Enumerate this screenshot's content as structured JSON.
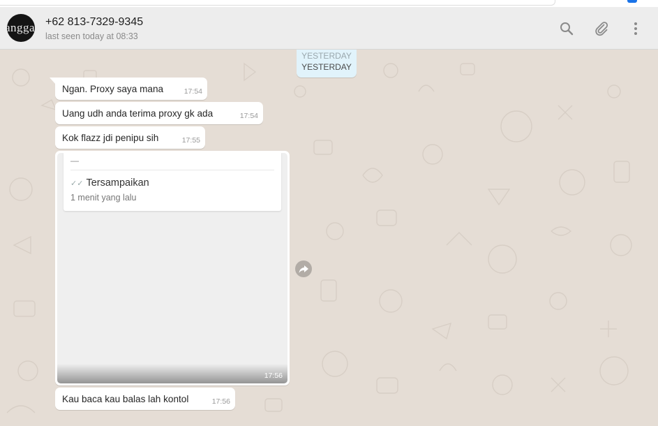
{
  "contact": {
    "name": "+62 813-7329-9345",
    "status": "last seen today at 08:33",
    "avatar_text": "angga"
  },
  "header_icons": [
    "search-icon",
    "paperclip-icon",
    "menu-dots-icon"
  ],
  "date_separator": {
    "ghost": "YESTERDAY",
    "label": "YESTERDAY"
  },
  "messages": [
    {
      "text": "Ngan. Proxy saya mana",
      "time": "17:54"
    },
    {
      "text": "Uang udh anda terima proxy gk ada",
      "time": "17:54"
    },
    {
      "text": "Kok flazz jdi penipu sih",
      "time": "17:55"
    },
    {
      "text": "Kau baca kau balas lah kontol",
      "time": "17:56"
    }
  ],
  "image_message": {
    "time": "17:56",
    "card_dash": "—",
    "status_ticks": "✓✓",
    "status_text": "Tersampaikan",
    "sub_text": "1 menit yang lalu"
  },
  "colors": {
    "header_bg": "#ededed",
    "chat_bg": "#e5ddd5",
    "bubble_bg": "#ffffff",
    "date_chip_bg": "#e1f3fb",
    "icon_gray": "#8a8a8a"
  }
}
